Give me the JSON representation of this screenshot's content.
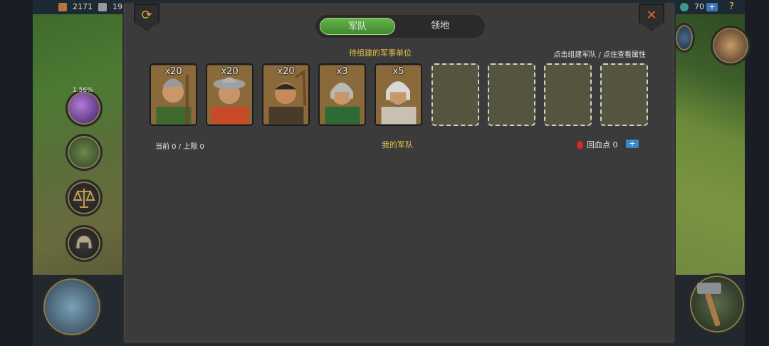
{
  "topbar": {
    "resource_1": "2171",
    "resource_2": "19",
    "gems": "70",
    "plus_label": "+",
    "help_label": "?"
  },
  "side": {
    "progress_pct": "1.56%"
  },
  "dialog": {
    "tabs": [
      {
        "label": "军队",
        "active": true
      },
      {
        "label": "领地",
        "active": false
      }
    ],
    "queue_title": "待组建的军事单位",
    "hint": "点击组建军队 / 点住查看属性",
    "units": [
      {
        "count": "x20",
        "icon": "spearman-portrait"
      },
      {
        "count": "x20",
        "icon": "musketeer-portrait"
      },
      {
        "count": "x20",
        "icon": "archer-portrait"
      },
      {
        "count": "x3",
        "icon": "light-cavalry-portrait"
      },
      {
        "count": "x5",
        "icon": "heavy-infantry-portrait"
      }
    ],
    "empty_slots": 4,
    "current_limit": "当前 0 / 上限 0",
    "my_army": "我的军队",
    "heal_label": "回血点",
    "heal_value": "0",
    "heal_plus": "+"
  },
  "colors": {
    "accent_gold": "#e8c14a",
    "tab_green": "#4a9a35",
    "panel_bg": "#3b3b3b"
  }
}
